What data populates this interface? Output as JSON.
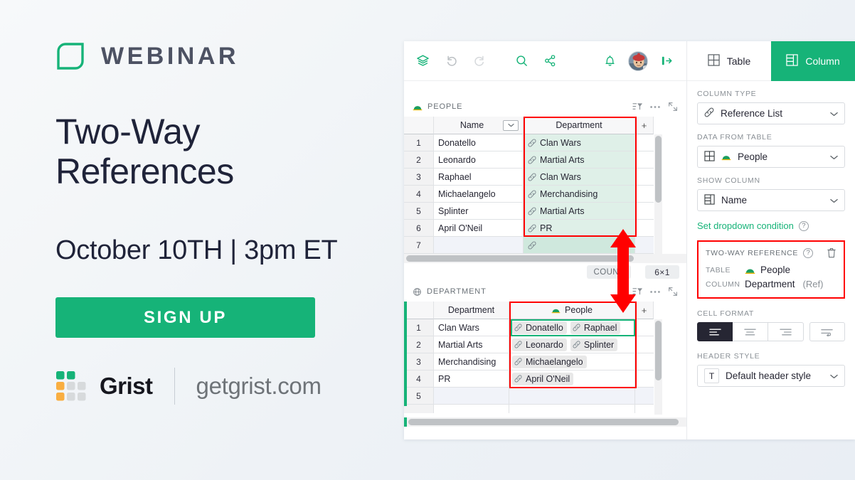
{
  "promo": {
    "logo_icon": "grist-leaf-icon",
    "kicker": "WEBINAR",
    "title_line1": "Two-Way",
    "title_line2": "References",
    "date": "October 10TH | 3pm ET",
    "cta": "SIGN UP",
    "brand_name": "Grist",
    "brand_url": "getgrist.com",
    "accent_green": "#16b378",
    "title_color": "#1f2339"
  },
  "app": {
    "toolbar": {
      "icons": [
        {
          "name": "layers-icon",
          "state": "enabled"
        },
        {
          "name": "undo-icon",
          "state": "disabled"
        },
        {
          "name": "redo-icon",
          "state": "disabled"
        },
        {
          "name": "search-icon",
          "state": "enabled"
        },
        {
          "name": "share-icon",
          "state": "enabled"
        },
        {
          "name": "bell-icon",
          "state": "enabled"
        },
        {
          "name": "avatar",
          "state": "enabled"
        },
        {
          "name": "expand-panel-icon",
          "state": "enabled"
        }
      ]
    },
    "people_widget": {
      "title": "PEOPLE",
      "table_icon": "turtle-icon",
      "actions": [
        "sort-filter-icon",
        "more-options-icon",
        "expand-icon"
      ],
      "columns": [
        "",
        "Name",
        "Department",
        "+"
      ],
      "rows": [
        {
          "num": "1",
          "name": "Donatello",
          "department": "Clan Wars"
        },
        {
          "num": "2",
          "name": "Leonardo",
          "department": "Martial Arts"
        },
        {
          "num": "3",
          "name": "Raphael",
          "department": "Clan Wars"
        },
        {
          "num": "4",
          "name": "Michaelangelo",
          "department": "Merchandising"
        },
        {
          "num": "5",
          "name": "Splinter",
          "department": "Martial Arts"
        },
        {
          "num": "6",
          "name": "April O'Neil",
          "department": "PR"
        },
        {
          "num": "7",
          "name": "",
          "department": ""
        }
      ],
      "footer_badges": [
        "COUNT",
        "6×1"
      ]
    },
    "department_widget": {
      "title": "DEPARTMENT",
      "table_icon": "department-icon",
      "actions": [
        "sort-filter-icon",
        "more-options-icon",
        "expand-icon"
      ],
      "columns": [
        "",
        "Department",
        "People",
        "+"
      ],
      "people_col_icon": "turtle-icon",
      "rows": [
        {
          "num": "1",
          "department": "Clan Wars",
          "people": [
            "Donatello",
            "Raphael"
          ]
        },
        {
          "num": "2",
          "department": "Martial Arts",
          "people": [
            "Leonardo",
            "Splinter"
          ]
        },
        {
          "num": "3",
          "department": "Merchandising",
          "people": [
            "Michaelangelo"
          ]
        },
        {
          "num": "4",
          "department": "PR",
          "people": [
            "April O'Neil"
          ]
        },
        {
          "num": "5",
          "department": "",
          "people": []
        }
      ]
    },
    "right_panel": {
      "tabs": [
        {
          "label": "Table",
          "icon": "table-icon",
          "active": false
        },
        {
          "label": "Column",
          "icon": "column-icon",
          "active": true
        }
      ],
      "column_type": {
        "label": "COLUMN TYPE",
        "value": "Reference List",
        "icon": "link-icon"
      },
      "data_from_table": {
        "label": "DATA FROM TABLE",
        "value": "People",
        "icon": "table-icon",
        "badge_icon": "turtle-icon"
      },
      "show_column": {
        "label": "SHOW COLUMN",
        "value": "Name",
        "icon": "column-icon"
      },
      "dropdown_condition": {
        "label": "Set dropdown condition",
        "help": "?"
      },
      "two_way_reference": {
        "label": "TWO-WAY REFERENCE",
        "help": "?",
        "delete_icon": "trash-icon",
        "table_key": "TABLE",
        "table_value": "People",
        "table_icon": "turtle-icon",
        "column_key": "COLUMN",
        "column_value": "Department",
        "column_suffix": "(Ref)",
        "highlight_color": "#ff0000"
      },
      "cell_format": {
        "label": "CELL FORMAT",
        "options": [
          "align-left",
          "align-center",
          "align-right",
          "wrap-text"
        ],
        "selected": "align-left"
      },
      "header_style": {
        "label": "HEADER STYLE",
        "value": "Default header style",
        "icon": "text-icon"
      }
    },
    "annotation": {
      "name": "two-way-sync-arrow",
      "color": "#ff0000"
    }
  }
}
